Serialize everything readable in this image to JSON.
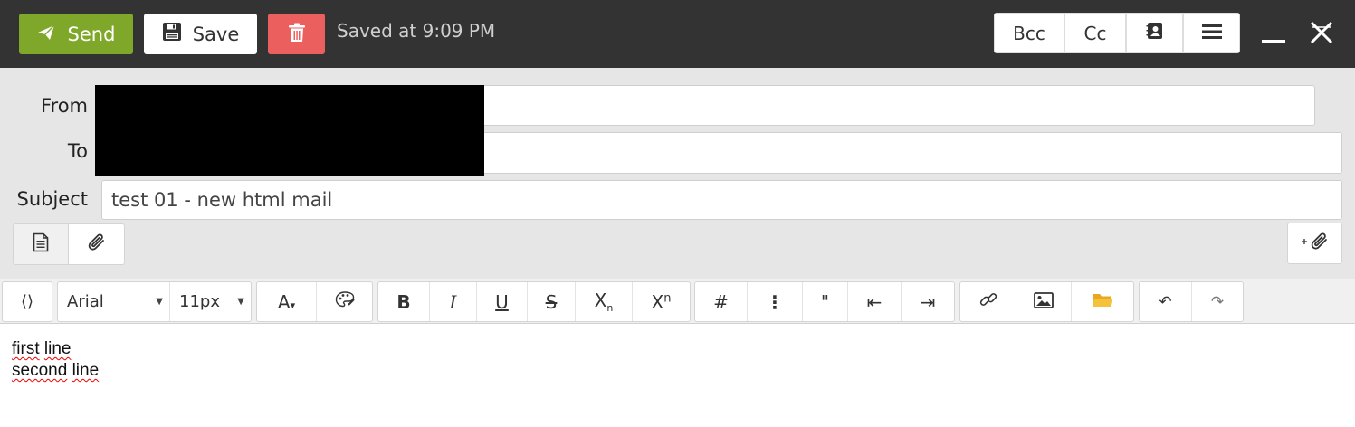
{
  "toolbar": {
    "send_label": "Send",
    "save_label": "Save",
    "saved_status": "Saved at 9:09 PM",
    "bcc_label": "Bcc",
    "cc_label": "Cc"
  },
  "colors": {
    "send_green": "#7fa82a",
    "delete_red": "#ec5f5f",
    "topbar_dark": "#333333",
    "folder_yellow": "#f5c33b"
  },
  "form": {
    "from_label": "From",
    "to_label": "To",
    "subject_label": "Subject",
    "subject_value": "test 01 - new html mail"
  },
  "editor_toolbar": {
    "font_family": "Arial",
    "font_size": "11px",
    "subscript_label": "Xn",
    "superscript_label": "Xn"
  },
  "editor": {
    "line1_word1": "first",
    "line1_word2": "line",
    "line2_word1": "second",
    "line2_word2": "line"
  }
}
